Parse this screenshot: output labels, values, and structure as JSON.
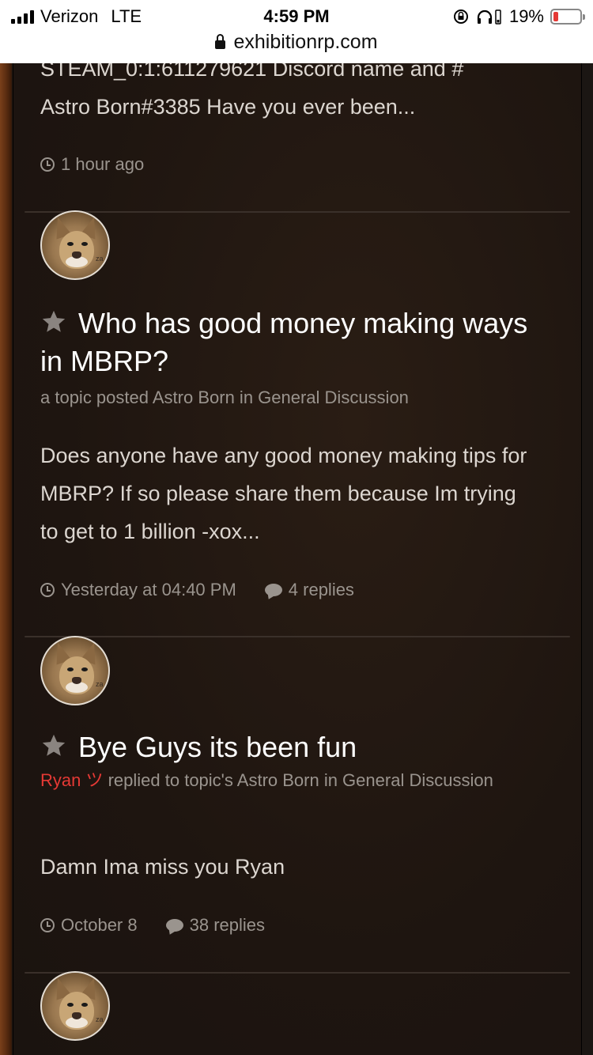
{
  "status_bar": {
    "carrier": "Verizon",
    "network": "LTE",
    "time": "4:59 PM",
    "battery_percent": "19%",
    "battery_level": 0.19,
    "battery_color": "#e53935",
    "url": "exhibitionrp.com",
    "icons": [
      "signal-icon",
      "rotation-lock-icon",
      "headphones-icon",
      "battery-icon",
      "lock-icon"
    ]
  },
  "posts": [
    {
      "excerpt_lines": [
        "STEAM_0:1:611279621 Discord name and #",
        "Astro Born#3385 Have you ever been..."
      ],
      "time": "1 hour ago"
    },
    {
      "avatar_tag": "za",
      "title": "Who has good money making ways in MBRP?",
      "subtitle": "a topic posted Astro Born in General Discussion",
      "excerpt": "Does anyone have any good money making tips for MBRP? If so please share them because Im trying to get to 1 billion -xox...",
      "time": "Yesterday at 04:40 PM",
      "replies": "4 replies"
    },
    {
      "avatar_tag": "za",
      "title": "Bye Guys its been fun",
      "user": "Ryan ツ",
      "subtitle_rest": " replied to topic's Astro Born in General Discussion",
      "excerpt": "Damn Ima miss you Ryan",
      "time": "October 8",
      "replies": "38 replies"
    },
    {
      "avatar_tag": "za"
    }
  ],
  "colors": {
    "user_highlight": "#e53935",
    "panel": "#1e1510",
    "text": "#dcd6d0",
    "muted": "#9a948e"
  }
}
